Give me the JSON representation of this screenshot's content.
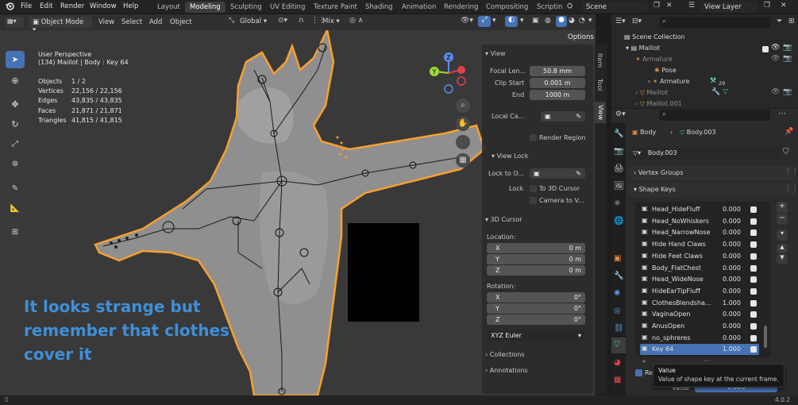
{
  "topbar": {
    "menus": [
      "File",
      "Edit",
      "Render",
      "Window",
      "Help"
    ],
    "workspaces": [
      "Layout",
      "Modeling",
      "Sculpting",
      "UV Editing",
      "Texture Paint",
      "Shading",
      "Animation",
      "Rendering",
      "Compositing",
      "Scriptin"
    ],
    "active_workspace": "Modeling",
    "scene": "Scene",
    "view_layer": "View Layer"
  },
  "viewport_header": {
    "mode": "Object Mode",
    "menus": [
      "View",
      "Select",
      "Add",
      "Object"
    ],
    "orientation": "Global",
    "snap": "Mix",
    "options": "Options"
  },
  "overlay_info": {
    "line1": "User Perspective",
    "line2": "(134) Maillot | Body : Key 64",
    "stats": [
      {
        "label": "Objects",
        "value": "1 / 2"
      },
      {
        "label": "Vertices",
        "value": "22,156 / 22,156"
      },
      {
        "label": "Edges",
        "value": "43,835 / 43,835"
      },
      {
        "label": "Faces",
        "value": "21,871 / 21,871"
      },
      {
        "label": "Triangles",
        "value": "41,815 / 41,815"
      }
    ]
  },
  "caption": {
    "line1": "It looks strange but",
    "line2": "remember that clothes",
    "line3": "cover it"
  },
  "gizmo": {
    "x": "X",
    "y": "Y",
    "z": "Z"
  },
  "npanel": {
    "tabs": [
      "Item",
      "Tool",
      "View"
    ],
    "view_header": "View",
    "focal_label": "Focal Len...",
    "focal_value": "50.8 mm",
    "clip_start_label": "Clip Start",
    "clip_start_value": "0.001 m",
    "end_label": "End",
    "end_value": "1000 m",
    "local_cam_label": "Local Ca...",
    "render_region": "Render Region",
    "view_lock_header": "View Lock",
    "lock_to_label": "Lock to O...",
    "lock_label": "Lock",
    "to_3d_cursor": "To 3D Cursor",
    "camera_to_view": "Camera to V...",
    "cursor_header": "3D Cursor",
    "location_label": "Location:",
    "loc": [
      {
        "axis": "X",
        "value": "0 m"
      },
      {
        "axis": "Y",
        "value": "0 m"
      },
      {
        "axis": "Z",
        "value": "0 m"
      }
    ],
    "rotation_label": "Rotation:",
    "rot": [
      {
        "axis": "X",
        "value": "0°"
      },
      {
        "axis": "Y",
        "value": "0°"
      },
      {
        "axis": "Z",
        "value": "0°"
      }
    ],
    "rot_mode": "XYZ Euler",
    "collections": "Collections",
    "annotations": "Annotations"
  },
  "outliner": {
    "root": "Scene Collection",
    "items": [
      {
        "label": "Maillot",
        "indent": 0
      },
      {
        "label": "Armature",
        "indent": 1
      },
      {
        "label": "Pose",
        "indent": 2
      },
      {
        "label": "Armature",
        "indent": 2
      },
      {
        "label": "Maillot",
        "indent": 1
      },
      {
        "label": "Maillot.001",
        "indent": 1
      }
    ],
    "badge": "29"
  },
  "properties": {
    "breadcrumb_obj": "Body",
    "breadcrumb_data": "Body.003",
    "mesh_name": "Body.003",
    "vertex_groups": "Vertex Groups",
    "shape_keys_header": "Shape Keys",
    "shape_keys": [
      {
        "name": "Head_HideFluff",
        "value": "0.000"
      },
      {
        "name": "Head_NoWhiskers",
        "value": "0.000"
      },
      {
        "name": "Head_NarrowNose",
        "value": "0.000"
      },
      {
        "name": "Hide Hand Claws",
        "value": "0.000"
      },
      {
        "name": "Hide Feet Claws",
        "value": "0.000"
      },
      {
        "name": "Body_FlatChest",
        "value": "0.000"
      },
      {
        "name": "Head_WideNose",
        "value": "0.000"
      },
      {
        "name": "HideEarTipFluff",
        "value": "0.000"
      },
      {
        "name": "ClothesBlendsha...",
        "value": "1.000"
      },
      {
        "name": "VaginaOpen",
        "value": "0.000"
      },
      {
        "name": "AnusOpen",
        "value": "0.000"
      },
      {
        "name": "no_sphreres",
        "value": "0.000"
      },
      {
        "name": "Key 64",
        "value": "1.000"
      }
    ],
    "selected_key": "Key 64",
    "relative_partial": "Re",
    "value_partial": "Value",
    "value_field": "1.000"
  },
  "tooltip": {
    "title": "Value",
    "desc": "Value of shape key at the current frame."
  },
  "status": {
    "version": "4.0.2"
  },
  "colors": {
    "accent": "#4772b3",
    "outline": "#f5a030",
    "caption": "#3f8fd8"
  }
}
